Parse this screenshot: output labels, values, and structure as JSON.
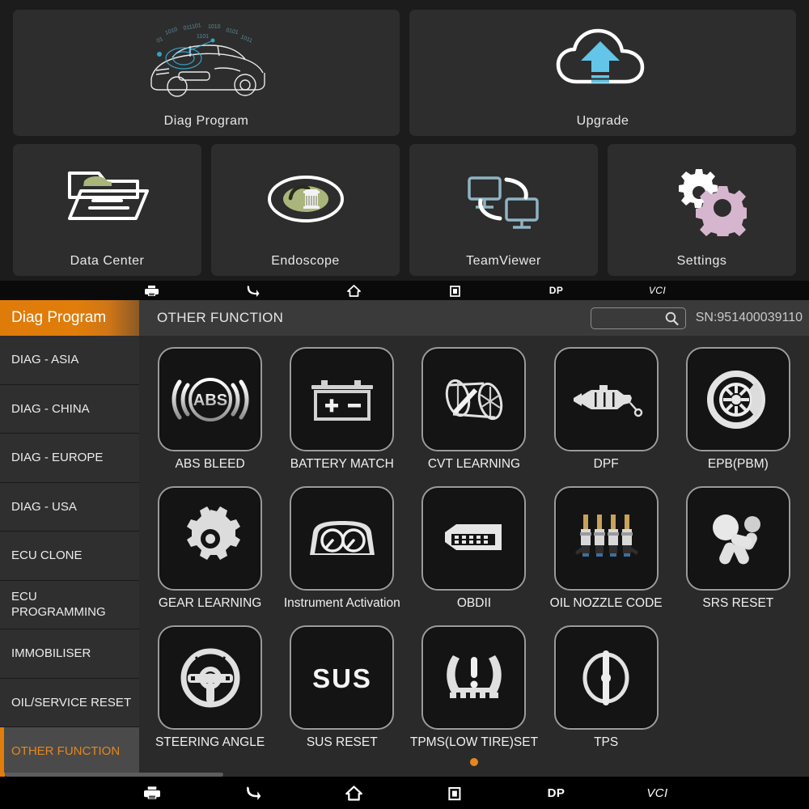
{
  "launcher": {
    "tiles_top": [
      {
        "label": "Diag Program",
        "icon": "sports-car-icon"
      },
      {
        "label": "Upgrade",
        "icon": "cloud-upload-icon"
      }
    ],
    "tiles_bottom": [
      {
        "label": "Data Center",
        "icon": "folder-car-icon"
      },
      {
        "label": "Endoscope",
        "icon": "endoscope-lens-icon"
      },
      {
        "label": "TeamViewer",
        "icon": "remote-screens-icon"
      },
      {
        "label": "Settings",
        "icon": "gears-icon"
      }
    ]
  },
  "navbar": {
    "items": [
      {
        "name": "print-icon",
        "label": ""
      },
      {
        "name": "back-icon",
        "label": ""
      },
      {
        "name": "home-icon",
        "label": ""
      },
      {
        "name": "recent-apps-icon",
        "label": ""
      },
      {
        "name": "dp-button",
        "label": "DP"
      },
      {
        "name": "vci-button",
        "label": "VCI"
      }
    ]
  },
  "header": {
    "app_tab": "Diag Program",
    "page_title": "OTHER FUNCTION",
    "search_placeholder": "",
    "search_value": "",
    "serial": "SN:951400039110",
    "accent_color": "#e07d0b"
  },
  "sidebar": {
    "items": [
      {
        "label": "DIAG - ASIA",
        "selected": false
      },
      {
        "label": "DIAG - CHINA",
        "selected": false
      },
      {
        "label": "DIAG - EUROPE",
        "selected": false
      },
      {
        "label": "DIAG - USA",
        "selected": false
      },
      {
        "label": "ECU CLONE",
        "selected": false
      },
      {
        "label": "ECU PROGRAMMING",
        "selected": false
      },
      {
        "label": "IMMOBILISER",
        "selected": false
      },
      {
        "label": "OIL/SERVICE RESET",
        "selected": false
      },
      {
        "label": "OTHER FUNCTION",
        "selected": true
      }
    ]
  },
  "functions": [
    {
      "label": "ABS BLEED",
      "icon": "abs-icon"
    },
    {
      "label": "BATTERY MATCH",
      "icon": "battery-icon"
    },
    {
      "label": "CVT LEARNING",
      "icon": "cvt-pulley-icon"
    },
    {
      "label": "DPF",
      "icon": "dpf-filter-icon"
    },
    {
      "label": "EPB(PBM)",
      "icon": "brake-disc-icon"
    },
    {
      "label": "GEAR LEARNING",
      "icon": "gear-icon"
    },
    {
      "label": "Instrument Activation",
      "icon": "dashboard-cluster-icon"
    },
    {
      "label": "OBDII",
      "icon": "obd-connector-icon"
    },
    {
      "label": "OIL NOZZLE CODE",
      "icon": "injectors-icon"
    },
    {
      "label": "SRS RESET",
      "icon": "airbag-dummy-icon"
    },
    {
      "label": "STEERING ANGLE",
      "icon": "steering-wheel-icon"
    },
    {
      "label": "SUS RESET",
      "icon": "sus-text-icon"
    },
    {
      "label": "TPMS(LOW TIRE)SET",
      "icon": "tpms-icon"
    },
    {
      "label": "TPS",
      "icon": "throttle-icon"
    }
  ],
  "pagination": {
    "pages": 1,
    "current": 1
  }
}
